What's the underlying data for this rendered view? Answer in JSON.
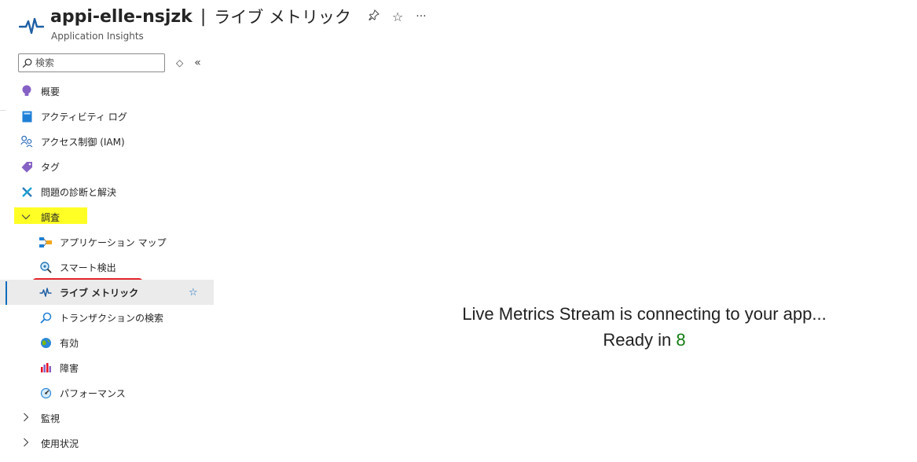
{
  "header": {
    "resource_name": "appi-elle-nsjzk",
    "separator": "|",
    "page_title": "ライブ メトリック",
    "subtitle": "Application Insights",
    "pin_icon": "pin-icon",
    "favorite_icon": "star-icon",
    "more_icon": "ellipsis-icon"
  },
  "search": {
    "placeholder": "検索"
  },
  "nav": {
    "overview": "概要",
    "activity_log": "アクティビティ ログ",
    "access_control": "アクセス制御 (IAM)",
    "tags": "タグ",
    "diagnose": "問題の診断と解決",
    "investigate": "調査",
    "app_map": "アプリケーション マップ",
    "smart_detection": "スマート検出",
    "live_metrics": "ライブ メトリック",
    "transaction_search": "トランザクションの検索",
    "availability": "有効",
    "failures": "障害",
    "performance": "パフォーマンス",
    "monitoring": "監視",
    "usage": "使用状況"
  },
  "main": {
    "message_line1": "Live Metrics Stream is connecting to your app...",
    "message_line2_prefix": "Ready in ",
    "countdown": "8"
  },
  "colors": {
    "accent": "#0f6cbd",
    "highlight": "#ffff26",
    "callout_border": "#e0242b",
    "countdown": "#107c10"
  }
}
